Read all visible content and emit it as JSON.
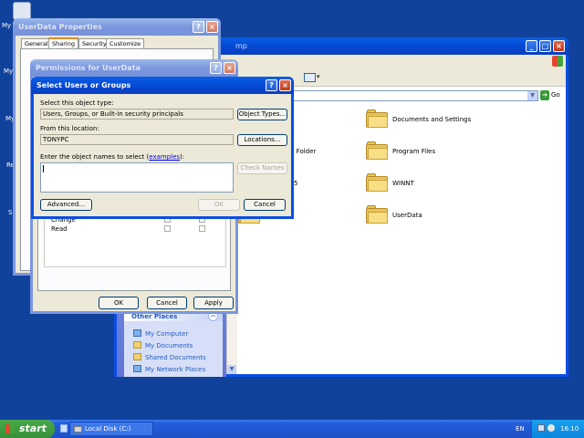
{
  "desktop": {
    "icons": [
      {
        "label": "My"
      },
      {
        "label": "My"
      },
      {
        "label": "My"
      },
      {
        "label": "Re"
      },
      {
        "label": "S"
      }
    ]
  },
  "explorer": {
    "title_suffix": "mp",
    "address_go": "Go",
    "items": [
      {
        "name": "Documents and Settings"
      },
      {
        "name": "Program Files"
      },
      {
        "name": "WINNT"
      },
      {
        "name": "UserData"
      }
    ],
    "partial_items": [
      {
        "name": "d Folder"
      },
      {
        "name": "5"
      }
    ],
    "sidebar": {
      "heading": "Other Places",
      "links": [
        "My Computer",
        "My Documents",
        "Shared Documents",
        "My Network Places"
      ]
    }
  },
  "properties": {
    "title": "UserData Properties",
    "tabs": [
      "General",
      "Sharing",
      "Security",
      "Customize"
    ]
  },
  "permissions": {
    "title": "Permissions for UserData",
    "rows": [
      "Change",
      "Read"
    ],
    "ok": "OK",
    "cancel": "Cancel",
    "apply": "Apply"
  },
  "select_dialog": {
    "title": "Select Users or Groups",
    "object_type_label": "Select this object type:",
    "object_type_value": "Users, Groups, or Built-in security principals",
    "object_types_button": "Object Types...",
    "location_label": "From this location:",
    "location_value": "TONYPC",
    "locations_button": "Locations...",
    "names_label_prefix": "Enter the object names to select (",
    "names_label_link": "examples",
    "names_label_suffix": "):",
    "check_names_button": "Check Names",
    "advanced_button": "Advanced...",
    "ok_button": "OK",
    "cancel_button": "Cancel"
  },
  "taskbar": {
    "start_label": "start",
    "task_label": "Local Disk (C:)",
    "lang": "EN",
    "clock": "16:10"
  },
  "colors": {
    "desktop": "#10429c",
    "taskbar": "#245edb",
    "start": "#3c9a3c",
    "title_active": "#0449d3"
  }
}
